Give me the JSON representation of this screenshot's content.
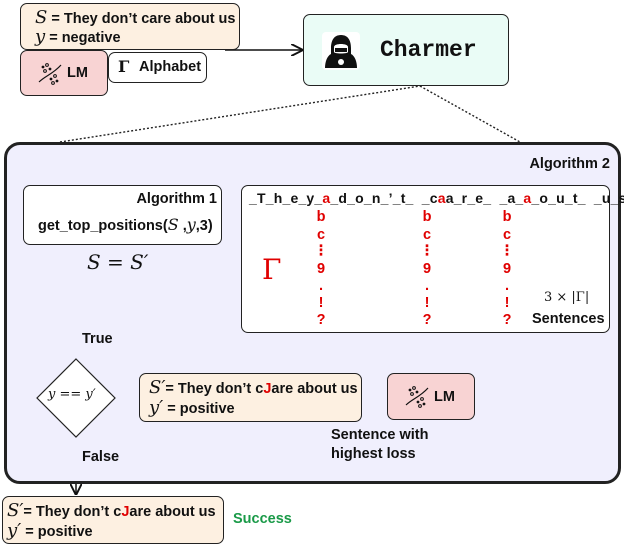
{
  "input": {
    "s_symbol": "S",
    "s_text": "= They don’t care about us",
    "y_symbol": "y",
    "y_text": "= negative"
  },
  "lm_label": "LM",
  "alphabet": {
    "symbol": "Γ",
    "label": "Alphabet"
  },
  "charmer": {
    "title": "Charmer",
    "icon": "hacker-icon"
  },
  "algorithm2": {
    "title": "Algorithm 2",
    "sentence_pieces": [
      "_T_h_e_y_",
      "a",
      "_d_o_n_’_t_  _c",
      "a",
      "a_r_e_  _a_",
      "a",
      "_o_u_t_  _u_s_"
    ],
    "gamma_symbol": "Γ",
    "candidates": [
      "b",
      "c",
      "⋮",
      "9",
      ".",
      "!",
      "?"
    ],
    "count_formula": "3 × |Γ|",
    "count_label": "Sentences"
  },
  "algorithm1": {
    "title": "Algorithm 1",
    "call_prefix": "get_top_positions(",
    "call_s": "S",
    "call_sep1": " ,",
    "call_y": "y",
    "call_suffix": ",3)"
  },
  "update_label": "S = S′",
  "true_label": "True",
  "false_label": "False",
  "condition": "y == y′",
  "perturbed": {
    "s_symbol": "S′",
    "s_pre": "= They don’t c",
    "s_inserted": "J",
    "s_post": "are about us",
    "y_symbol": "y′",
    "y_text": "= positive"
  },
  "highest_loss_label": [
    "Sentence with",
    "highest loss"
  ],
  "success_label": "Success",
  "colors": {
    "peach": "#fdf0e1",
    "pink": "#f8d3d3",
    "mint": "#eafcf6",
    "lavender": "#f0effd",
    "red": "#e00000",
    "green": "#1a9a48"
  }
}
